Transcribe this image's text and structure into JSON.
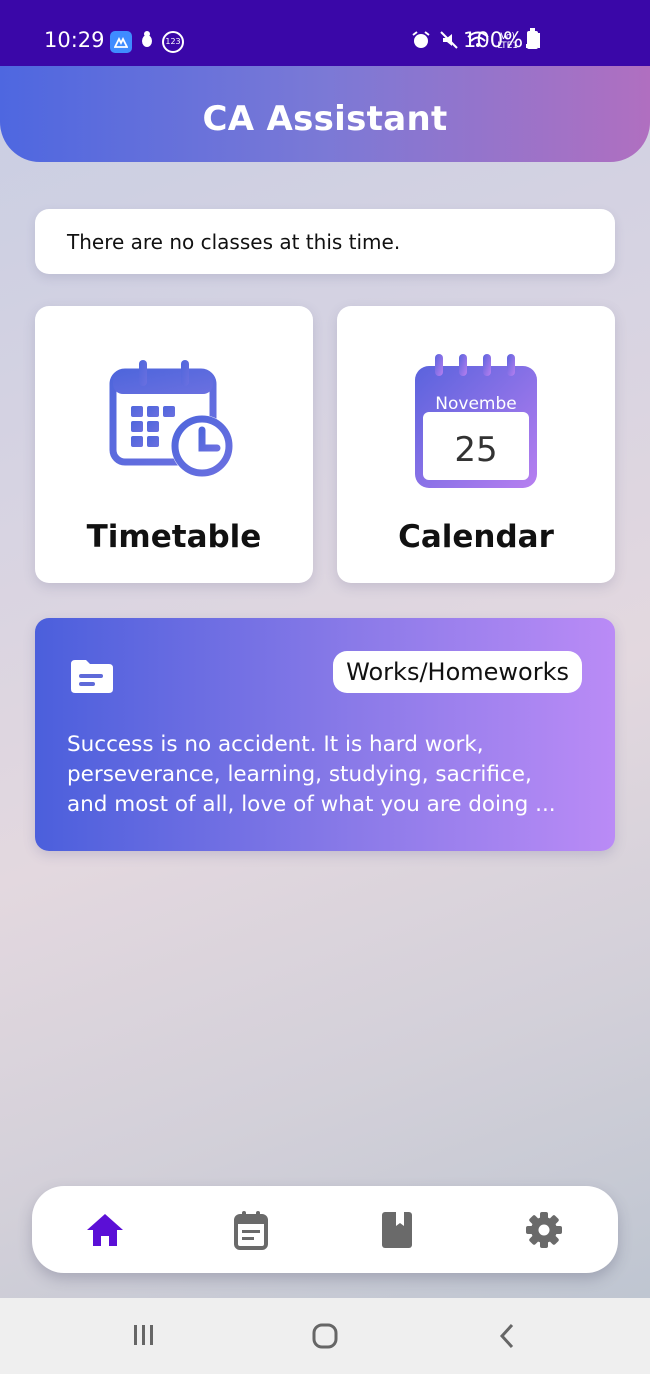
{
  "status_bar": {
    "time": "10:29",
    "app_badge": "⌂",
    "network_top": "Vo)",
    "network_bottom": "LTE1",
    "battery": "100%"
  },
  "header": {
    "title": "CA Assistant"
  },
  "notice": {
    "text": "There are no classes at this time."
  },
  "tiles": [
    {
      "label": "Timetable",
      "icon": "calendar-clock-icon"
    },
    {
      "label": "Calendar",
      "icon": "calendar-date-icon",
      "month": "Novembe",
      "day": "25"
    }
  ],
  "works": {
    "button_label": "Works/Homeworks",
    "quote_lines": [
      "Success is no accident. It is hard work,",
      "perseverance, learning, studying, sacrifice,",
      "and most of all, love of what you are doing ..."
    ],
    "icon": "folder-icon"
  },
  "bottom_nav": [
    {
      "icon": "home-icon",
      "active": true
    },
    {
      "icon": "schedule-icon",
      "active": false
    },
    {
      "icon": "book-icon",
      "active": false
    },
    {
      "icon": "settings-icon",
      "active": false
    }
  ],
  "colors": {
    "status_bar": "#3a07a8",
    "header_start": "#4e67e0",
    "header_end": "#b06fc0",
    "nav_active": "#5b0fd6",
    "nav_inactive": "#6a6a6a"
  }
}
